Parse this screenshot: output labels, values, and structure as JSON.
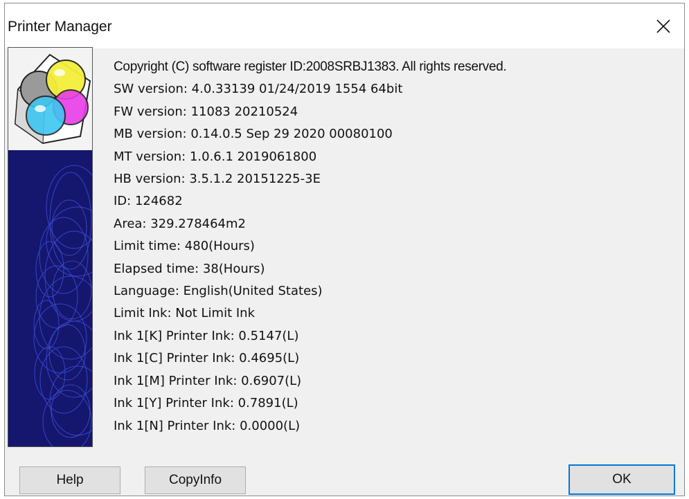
{
  "window": {
    "title": "Printer Manager",
    "close_glyph": "✕"
  },
  "info": {
    "lines": [
      "Copyright (C) software register ID:2008SRBJ1383. All rights reserved.",
      "SW version: 4.0.33139 01/24/2019 1554 64bit",
      "FW version: 11083 20210524",
      "MB version: 0.14.0.5 Sep 29 2020 00080100",
      "MT version: 1.0.6.1 2019061800",
      "HB version: 3.5.1.2 20151225-3E",
      "ID: 124682",
      "Area: 329.278464m2",
      "Limit time: 480(Hours)",
      "Elapsed time: 38(Hours)",
      "Language: English(United States)",
      "Limit Ink: Not Limit Ink",
      "Ink 1[K] Printer Ink: 0.5147(L)",
      "Ink 1[C] Printer Ink: 0.4695(L)",
      "Ink 1[M] Printer Ink: 0.6907(L)",
      "Ink 1[Y] Printer Ink: 0.7891(L)",
      "Ink 1[N] Printer Ink: 0.0000(L)"
    ]
  },
  "buttons": {
    "help": "Help",
    "copyinfo": "CopyInfo",
    "ok": "OK"
  },
  "colors": {
    "accent": "#0078d7",
    "panel_blue": "#15166e",
    "dialog_bg": "#f0f0f0"
  },
  "icons": {
    "logo": "printer-manager-logo-icon",
    "close": "close-icon"
  }
}
